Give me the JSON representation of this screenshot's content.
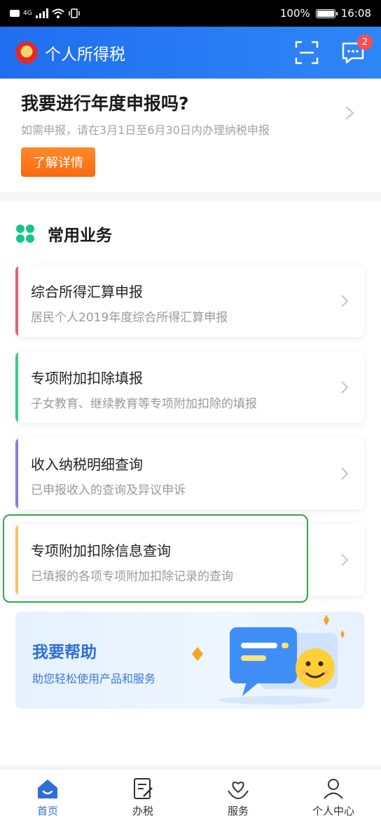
{
  "status_bar": {
    "network": "4G",
    "battery": "100%",
    "time": "16:08"
  },
  "header": {
    "title": "个人所得税",
    "message_badge": "2",
    "scan_icon": "scan-icon",
    "message_icon": "message-icon"
  },
  "promo": {
    "title": "我要进行年度申报吗?",
    "subtitle": "如需申报，请在3月1日至6月30日内办理纳税申报",
    "button": "了解详情"
  },
  "common": {
    "title": "常用业务",
    "items": [
      {
        "title": "综合所得汇算申报",
        "subtitle": "居民个人2019年度综合所得汇算申报",
        "accent": "#e2627a"
      },
      {
        "title": "专项附加扣除填报",
        "subtitle": "子女教育、继续教育等专项附加扣除的填报",
        "accent": "#3ec98c"
      },
      {
        "title": "收入纳税明细查询",
        "subtitle": "已申报收入的查询及异议申诉",
        "accent": "#8c7ae6"
      },
      {
        "title": "专项附加扣除信息查询",
        "subtitle": "已填报的各项专项附加扣除记录的查询",
        "accent": "#f2c46a"
      }
    ]
  },
  "help": {
    "title": "我要帮助",
    "subtitle": "助您轻松使用产品和服务"
  },
  "tabs": [
    {
      "label": "首页",
      "icon": "home-icon"
    },
    {
      "label": "办税",
      "icon": "document-icon"
    },
    {
      "label": "服务",
      "icon": "heart-hand-icon"
    },
    {
      "label": "个人中心",
      "icon": "user-icon"
    }
  ],
  "colors": {
    "primary": "#2f6fd6",
    "orange": "#f86a0f",
    "highlight": "#2fa84a"
  }
}
